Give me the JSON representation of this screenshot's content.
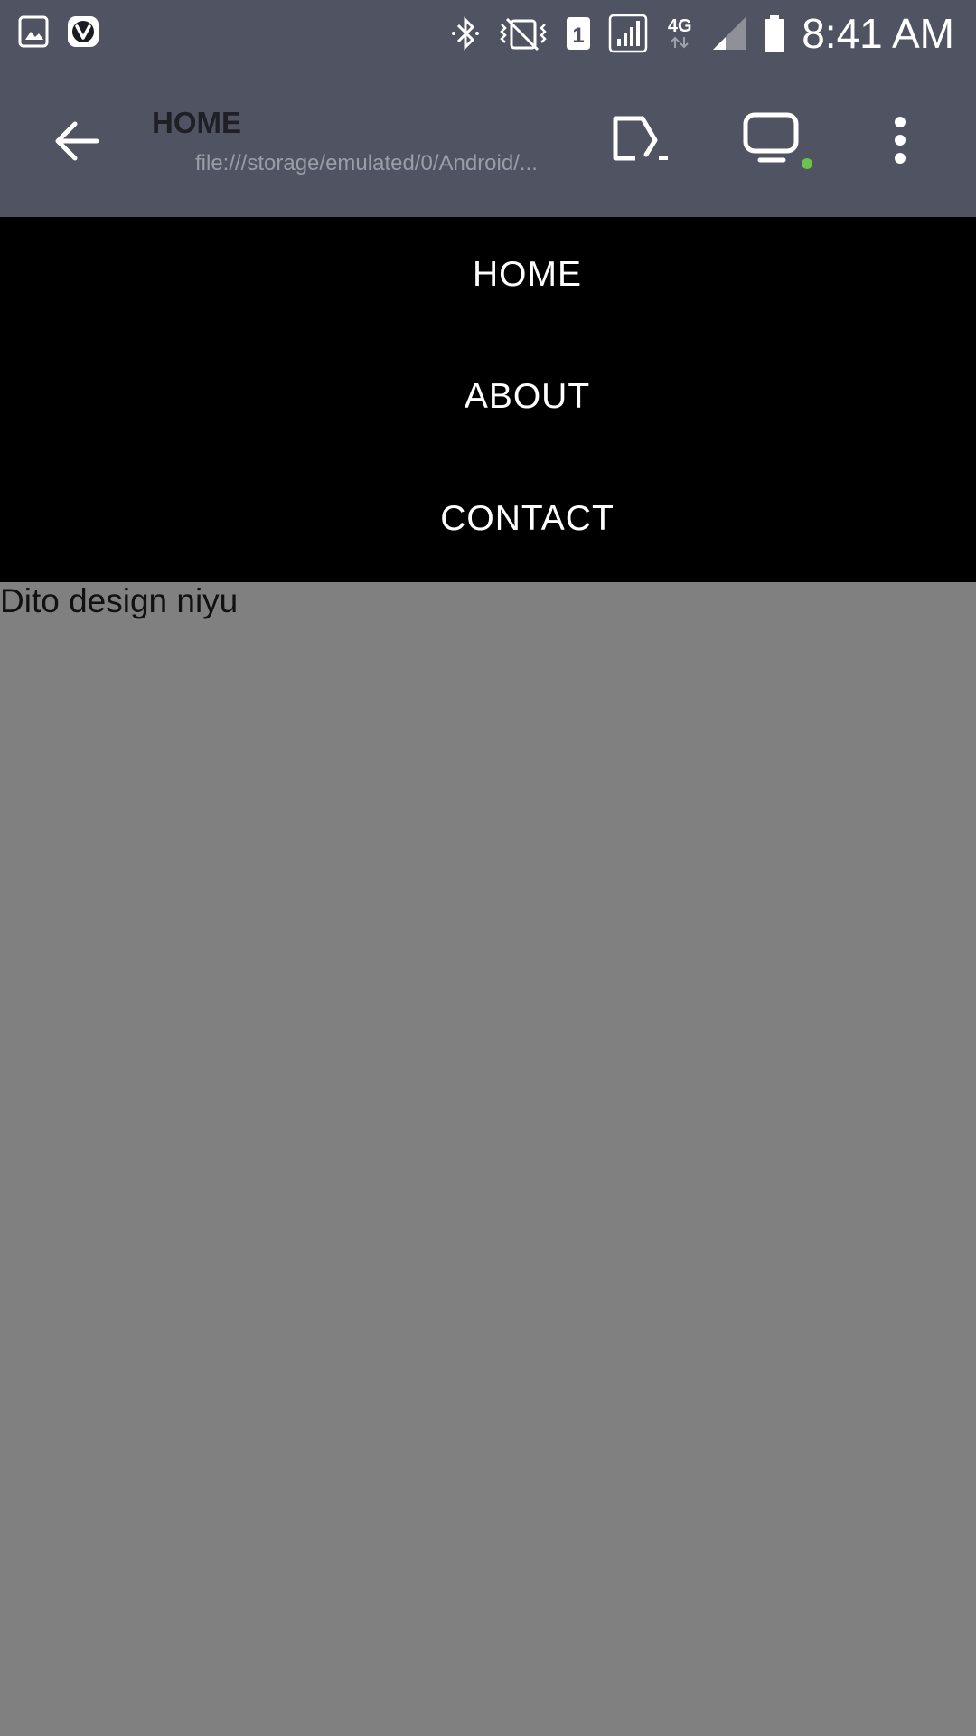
{
  "status_bar": {
    "time": "8:41 AM",
    "network_label": "4G",
    "sim_label": "1",
    "left_icons": [
      "gallery-icon",
      "vivaldi-icon"
    ],
    "right_icons": [
      "bluetooth-icon",
      "vibrate-icon",
      "sim-icon",
      "signal-icon",
      "network-4g-icon",
      "signal-weak-icon",
      "battery-icon"
    ]
  },
  "app_bar": {
    "title": "HOME",
    "url": "file:///storage/emulated/0/Android/...",
    "status_dot_color": "#6cc24a"
  },
  "nav_menu": {
    "items": [
      {
        "label": "HOME"
      },
      {
        "label": "ABOUT"
      },
      {
        "label": "CONTACT"
      }
    ]
  },
  "content": {
    "text": "Dito design niyu"
  },
  "colors": {
    "bar_background": "#505462",
    "menu_background": "#000000",
    "page_background": "#808080"
  }
}
